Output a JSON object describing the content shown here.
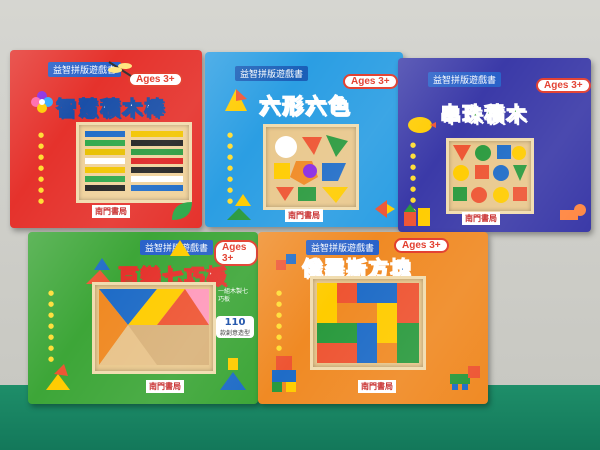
{
  "books": {
    "b1": {
      "series": "益智拼版遊戲書",
      "ages": "Ages 3+",
      "title": "智慧積木棒",
      "publisher": "南門書局"
    },
    "b2": {
      "series": "益智拼版遊戲書",
      "ages": "Ages 3+",
      "title": "六形六色",
      "publisher": "南門書局"
    },
    "b3": {
      "series": "益智拼版遊戲書",
      "ages": "Ages 3+",
      "title": "串珠積木",
      "publisher": "南門書局"
    },
    "b4": {
      "series": "益智拼版遊戲書",
      "ages": "Ages 3+",
      "title": "百變七巧板",
      "publisher": "南門書局",
      "badge": "110",
      "badge_sub": "款創意造型",
      "note": "一組木製七巧板"
    },
    "b5": {
      "series": "益智拼版遊戲書",
      "ages": "Ages 3+",
      "title": "俄羅斯方塊",
      "publisher": "南門書局"
    }
  },
  "colors": {
    "book1": "#e5322c",
    "book2": "#2b9ee3",
    "book3": "#3b3aa8",
    "book4": "#3da638",
    "book5": "#f08a24",
    "floor": "#168163"
  }
}
